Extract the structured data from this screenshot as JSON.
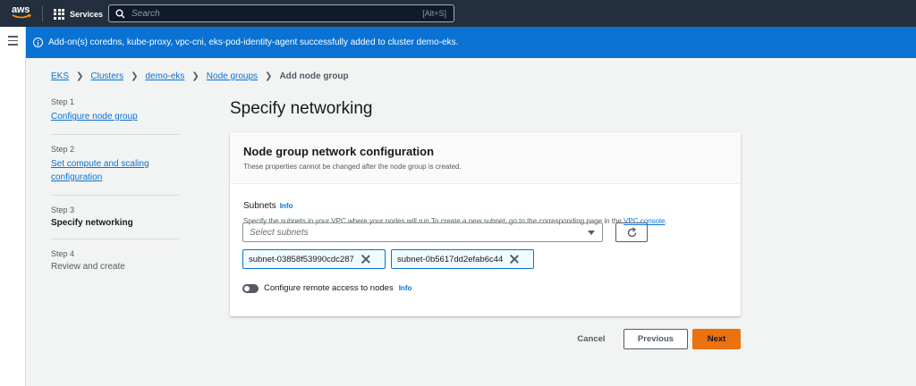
{
  "topnav": {
    "logo_text": "aws",
    "services_label": "Services",
    "search_placeholder": "Search",
    "search_shortcut": "[Alt+S]"
  },
  "flash": {
    "message": "Add-on(s) coredns, kube-proxy, vpc-cni, eks-pod-identity-agent successfully added to cluster demo-eks."
  },
  "breadcrumb": {
    "items": [
      "EKS",
      "Clusters",
      "demo-eks",
      "Node groups"
    ],
    "current": "Add node group"
  },
  "steps": [
    {
      "num": "Step 1",
      "label": "Configure node group"
    },
    {
      "num": "Step 2",
      "label": "Set compute and scaling configuration"
    },
    {
      "num": "Step 3",
      "label": "Specify networking"
    },
    {
      "num": "Step 4",
      "label": "Review and create"
    }
  ],
  "page": {
    "title": "Specify networking"
  },
  "panel": {
    "title": "Node group network configuration",
    "description": "These properties cannot be changed after the node group is created.",
    "subnets_label": "Subnets",
    "info_label": "Info",
    "subnets_desc": "Specify the subnets in your VPC where your nodes will run.To create a new subnet, go to the corresponding page in the",
    "vpc_link": "VPC console",
    "desc_end": ".",
    "select_placeholder": "Select subnets",
    "tokens": [
      "subnet-03858f53990cdc287",
      "subnet-0b5617dd2efab6c44"
    ],
    "remote_access_label": "Configure remote access to nodes",
    "remote_info": "Info"
  },
  "footer": {
    "cancel": "Cancel",
    "previous": "Previous",
    "next": "Next"
  },
  "colors": {
    "nav_bg": "#232f3e",
    "flash_bg": "#0972d3",
    "link": "#0972d3",
    "primary_button": "#ec7211"
  }
}
